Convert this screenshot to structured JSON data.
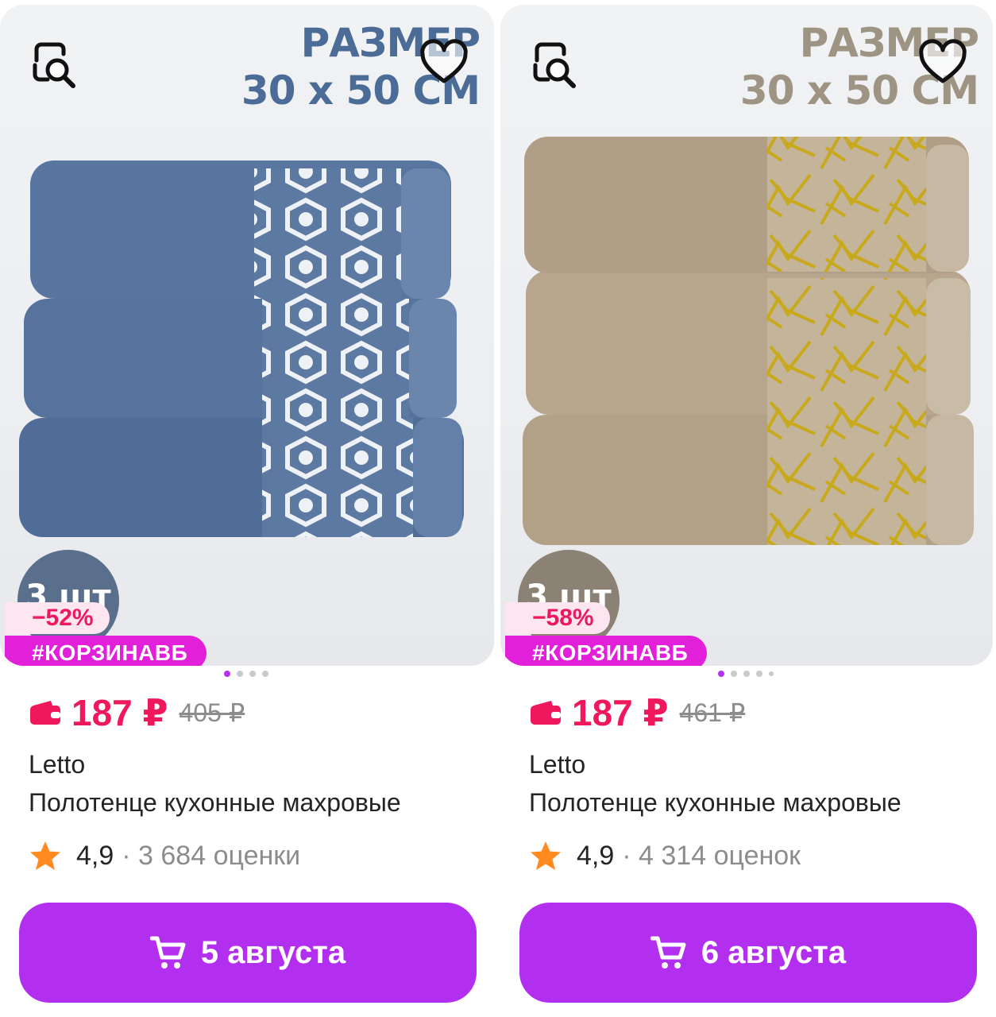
{
  "products": [
    {
      "size_line1": "РАЗМЕР",
      "size_line2": "30 x 50 СМ",
      "qty_badge": "3 шт",
      "discount": "−52%",
      "promo_tag": "#КОРЗИНАВБ",
      "price": "187 ₽",
      "old_price": "405 ₽",
      "brand": "Letto",
      "title": "Полотенце кухонные махровые",
      "rating": "4,9",
      "reviews": "· 3 684 оценки",
      "delivery": "5 августа",
      "towel_color": "#55739c",
      "photo_dots": 4
    },
    {
      "size_line1": "РАЗМЕР",
      "size_line2": "30 x 50 СМ",
      "qty_badge": "3 шт",
      "discount": "−58%",
      "promo_tag": "#КОРЗИНАВБ",
      "price": "187 ₽",
      "old_price": "461 ₽",
      "brand": "Letto",
      "title": "Полотенце кухонные махровые",
      "rating": "4,9",
      "reviews": "· 4 314 оценок",
      "delivery": "6 августа",
      "towel_color": "#b2a187",
      "photo_dots": 5
    }
  ],
  "colors": {
    "accent_purple": "#b22ff0",
    "price_pink": "#f0185d",
    "promo_magenta": "#e21fd9",
    "star_orange": "#ff8a1f"
  },
  "icons": {
    "similar": "search-similar-icon",
    "favorite": "heart-icon",
    "wallet": "wallet-icon",
    "star": "star-icon",
    "cart": "cart-icon"
  }
}
